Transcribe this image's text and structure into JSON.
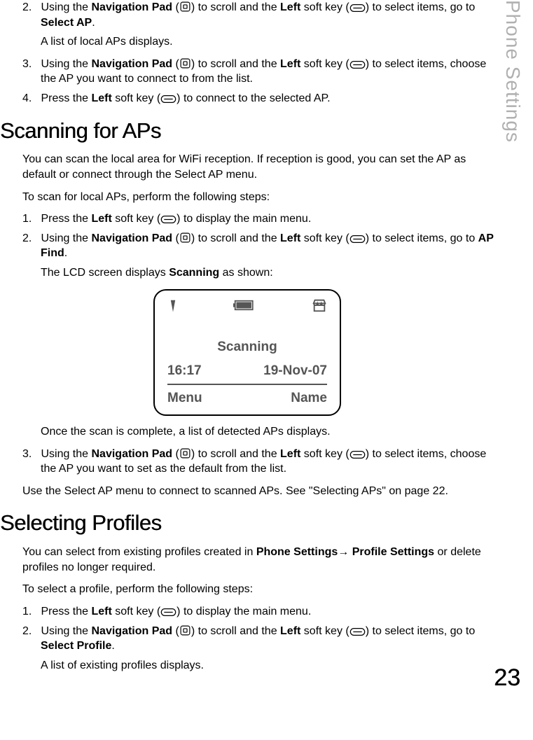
{
  "sideTab": "Phone Settings",
  "pageNumber": "23",
  "top": {
    "step2_pre": "Using the ",
    "navPad": "Navigation Pad",
    "scrollAnd": ") to scroll and the ",
    "leftKey": "Left",
    "softKey": " soft key (",
    "toSelect": ") to select items, go to ",
    "selectAP": "Select AP",
    "step2_sub": "A list of local APs displays.",
    "step3_tail": ") to select items, choose the AP you want to connect to from the list.",
    "step4_pre": "Press the ",
    "step4_tail": ") to connect to the selected AP."
  },
  "scan": {
    "heading": "Scanning for APs",
    "intro": "You can scan the local area for WiFi reception. If reception is good, you can set the AP as default or connect through the Select AP menu.",
    "prompt": "To scan for local APs, perform the following steps:",
    "step1_pre": "Press the ",
    "step1_tail": ") to display the main menu.",
    "apFind": "AP Find",
    "step2_goto": ") to select items, go to ",
    "step2_sub_pre": "The LCD screen displays ",
    "scanningWord": "Scanning",
    "step2_sub_post": " as shown:",
    "afterLcd": "Once the scan is complete, a list of detected APs displays.",
    "step3_tail": ") to select items, choose the AP you want to set as the default from the list.",
    "outro": "Use the Select AP menu to connect to scanned APs. See \"Selecting APs\" on page 22."
  },
  "lcd": {
    "center": "Scanning",
    "time": "16:17",
    "date": "19-Nov-07",
    "softLeft": "Menu",
    "softRight": "Name"
  },
  "profiles": {
    "heading": "Selecting Profiles",
    "intro_pre": "You can select from existing profiles created in ",
    "pathA": "Phone Settings",
    "arrow": "→",
    "pathB": "Profile Settings",
    "intro_post": " or delete profiles no longer required.",
    "prompt": "To select a profile, perform the following steps:",
    "step1_pre": "Press the ",
    "step1_tail": ") to display the main menu.",
    "step2_goto": ") to select items, go to ",
    "selectProfile": "Select Profile",
    "step2_sub": "A list of existing profiles displays."
  }
}
